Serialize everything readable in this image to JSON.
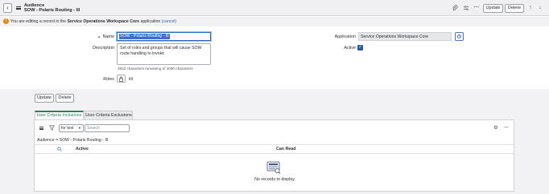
{
  "header": {
    "back_label": "‹",
    "title_line1": "Audience",
    "title_line2": "SOW - Polaris Routing - Ill",
    "icons": [
      "attachment-icon",
      "sliders-icon",
      "more-icon"
    ],
    "update_label": "Update",
    "delete_label": "Delete",
    "prev_label": "↑",
    "next_label": "↓"
  },
  "banner": {
    "prefix": "You are editing a record in the ",
    "app_name": "Service Operations Workspace Core",
    "suffix": " application ",
    "cancel_link": "(cancel)",
    "status_color": "#e8870e"
  },
  "form": {
    "name_label": "Name",
    "name_value": "SOW - Polaris Routing - Ill",
    "description_label": "Description",
    "description_value": "Set of roles and groups that will cause SOW route handling to invoke",
    "remaining_text": "3932 characters remaining of 4000 characters",
    "roles_label": "Roles",
    "roles_value": "itil",
    "application_label": "Application",
    "application_value": "Service Operations Workspace Core",
    "active_label": "Active",
    "active_checked": true
  },
  "actions": {
    "update_label": "Update",
    "delete_label": "Delete"
  },
  "tabs": [
    {
      "label": "User Criteria Inclusions",
      "active": true
    },
    {
      "label": "User Criteria Exclusions",
      "active": false
    }
  ],
  "related_list": {
    "filter_select": "for text",
    "search_placeholder": "Search",
    "breadcrumb": "Audience = SOW - Polaris Routing - Ill",
    "columns": [
      "Active",
      "Can Read"
    ],
    "empty_text": "No records to display",
    "accent_color": "#2e7d5b"
  }
}
